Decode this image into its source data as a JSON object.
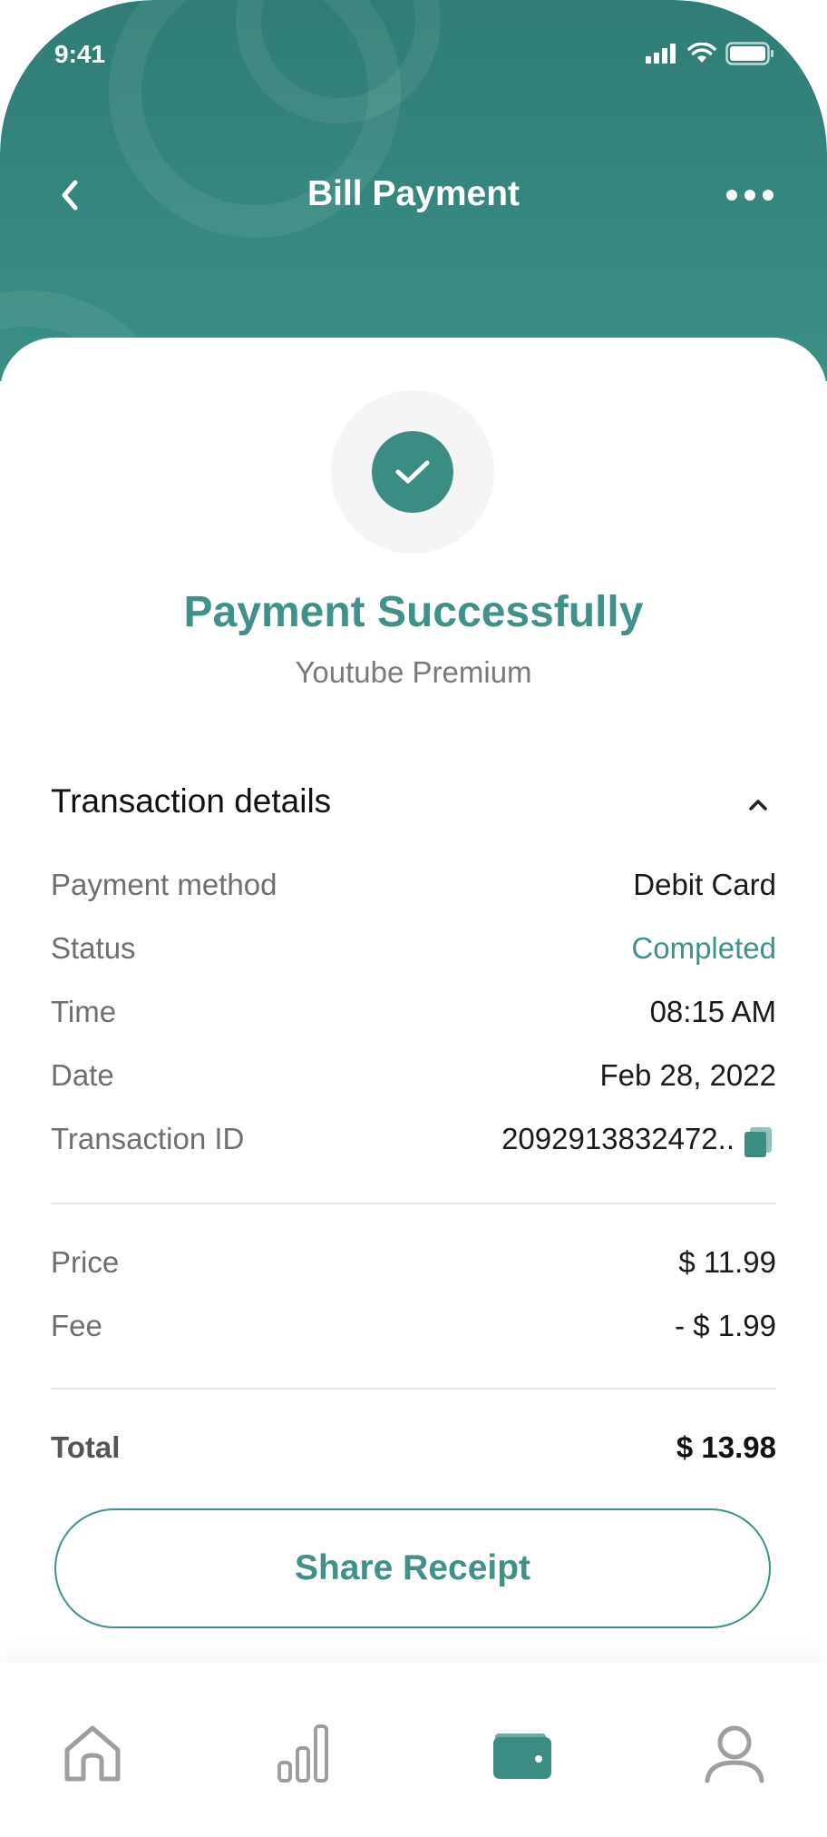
{
  "status_bar": {
    "time": "9:41"
  },
  "header": {
    "title": "Bill Payment"
  },
  "success": {
    "title": "Payment Successfully",
    "subtitle": "Youtube Premium"
  },
  "transaction": {
    "section_title": "Transaction details",
    "rows": [
      {
        "label": "Payment method",
        "value": "Debit Card"
      },
      {
        "label": "Status",
        "value": "Completed"
      },
      {
        "label": "Time",
        "value": "08:15 AM"
      },
      {
        "label": "Date",
        "value": "Feb 28, 2022"
      },
      {
        "label": "Transaction ID",
        "value": "2092913832472.."
      }
    ]
  },
  "pricing": {
    "price_label": "Price",
    "price_value": "$ 11.99",
    "fee_label": "Fee",
    "fee_value": "- $ 1.99",
    "total_label": "Total",
    "total_value": "$ 13.98"
  },
  "actions": {
    "share_label": "Share Receipt"
  },
  "tabbar": {
    "items": [
      {
        "icon": "home-icon",
        "active": false
      },
      {
        "icon": "chart-bars-icon",
        "active": false
      },
      {
        "icon": "wallet-icon",
        "active": true
      },
      {
        "icon": "profile-icon",
        "active": false
      }
    ]
  },
  "colors": {
    "primary": "#3b8d84",
    "header_bg": "#2f7d76",
    "accent_text": "#3f918a",
    "inactive_icon": "#9e9e9e"
  }
}
